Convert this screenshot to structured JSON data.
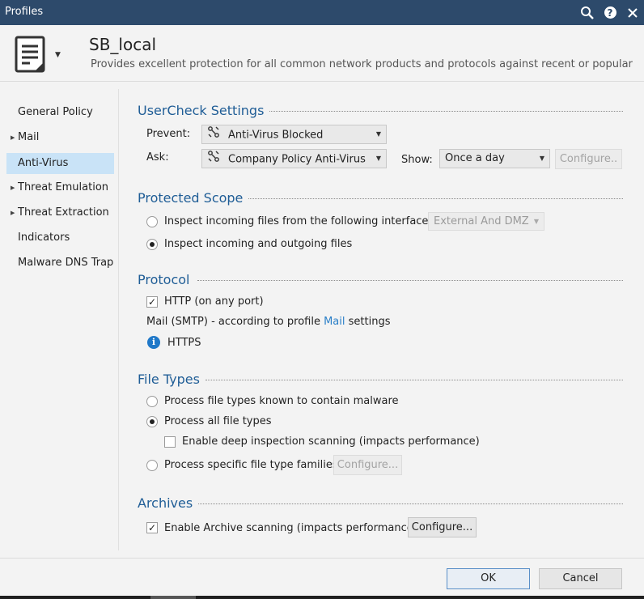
{
  "window": {
    "title": "Profiles",
    "icons": [
      "search-icon",
      "help-icon",
      "close-icon"
    ],
    "help_glyph": "?"
  },
  "profile": {
    "name": "SB_local",
    "description": "Provides excellent protection for all common network products and protocols against recent or popular atta..."
  },
  "sidebar": {
    "items": [
      {
        "label": "General Policy",
        "expandable": false
      },
      {
        "label": "Mail",
        "expandable": true
      },
      {
        "label": "Anti-Virus",
        "expandable": false,
        "selected": true
      },
      {
        "label": "Threat Emulation",
        "expandable": true
      },
      {
        "label": "Threat Extraction",
        "expandable": true
      },
      {
        "label": "Indicators",
        "expandable": false
      },
      {
        "label": "Malware DNS Trap",
        "expandable": false
      }
    ]
  },
  "usercheck": {
    "title": "UserCheck Settings",
    "prevent_label": "Prevent:",
    "prevent_value": "Anti-Virus Blocked",
    "ask_label": "Ask:",
    "ask_value": "Company Policy Anti-Virus",
    "show_label": "Show:",
    "show_value": "Once a day",
    "configure_label": "Configure.."
  },
  "protected_scope": {
    "title": "Protected Scope",
    "option1": "Inspect incoming files from the following interfaces:",
    "interfaces_value": "External And DMZ",
    "option2": "Inspect incoming and outgoing files",
    "selected": 2
  },
  "protocol": {
    "title": "Protocol",
    "http_label": "HTTP (on any port)",
    "http_checked": true,
    "mail_prefix": "Mail (SMTP) - according to profile",
    "mail_link": "Mail",
    "mail_suffix": "settings",
    "https_label": "HTTPS",
    "info_glyph": "i"
  },
  "file_types": {
    "title": "File Types",
    "option1": "Process file types known to contain malware",
    "option2": "Process all file types",
    "deep_inspection": "Enable deep inspection scanning (impacts performance)",
    "deep_checked": false,
    "option3": "Process specific file type families",
    "configure_label": "Configure...",
    "selected": 2
  },
  "archives": {
    "title": "Archives",
    "enable_label": "Enable Archive scanning (impacts performance)",
    "enable_checked": true,
    "configure_label": "Configure..."
  },
  "footer": {
    "ok_label": "OK",
    "cancel_label": "Cancel"
  },
  "colors": {
    "title_bar": "#2d4a6b",
    "section_title": "#1f5d96",
    "selected_item": "#c9e3f7",
    "link": "#2a7fc8"
  }
}
